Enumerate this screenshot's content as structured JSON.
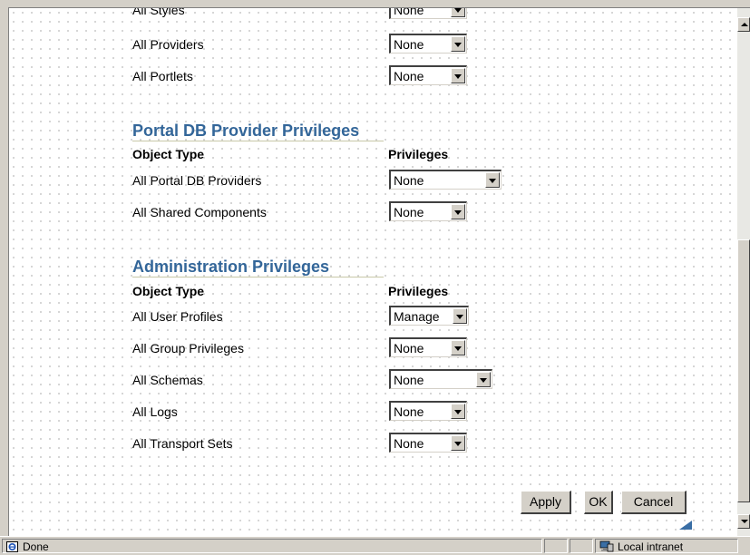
{
  "content": {
    "partial_row": {
      "label": "All Styles",
      "value": "None"
    },
    "general_rows": [
      {
        "label": "All Providers",
        "value": "None"
      },
      {
        "label": "All Portlets",
        "value": "None"
      }
    ],
    "portal_db": {
      "title": "Portal DB Provider Privileges",
      "col_object": "Object Type",
      "col_priv": "Privileges",
      "rows": [
        {
          "label": "All Portal DB Providers",
          "value": "None"
        },
        {
          "label": "All Shared Components",
          "value": "None"
        }
      ]
    },
    "admin": {
      "title": "Administration Privileges",
      "col_object": "Object Type",
      "col_priv": "Privileges",
      "rows": [
        {
          "label": "All User Profiles",
          "value": "Manage"
        },
        {
          "label": "All Group Privileges",
          "value": "None"
        },
        {
          "label": "All Schemas",
          "value": "None"
        },
        {
          "label": "All Logs",
          "value": "None"
        },
        {
          "label": "All Transport Sets",
          "value": "None"
        }
      ]
    },
    "buttons": {
      "apply": "Apply",
      "ok": "OK",
      "cancel": "Cancel"
    }
  },
  "status": {
    "text": "Done",
    "zone": "Local intranet"
  },
  "colors": {
    "section_title": "#336699",
    "chrome": "#d4d0c8"
  },
  "icons": {
    "status": "ie-page-icon",
    "zone": "local-intranet-icon"
  }
}
